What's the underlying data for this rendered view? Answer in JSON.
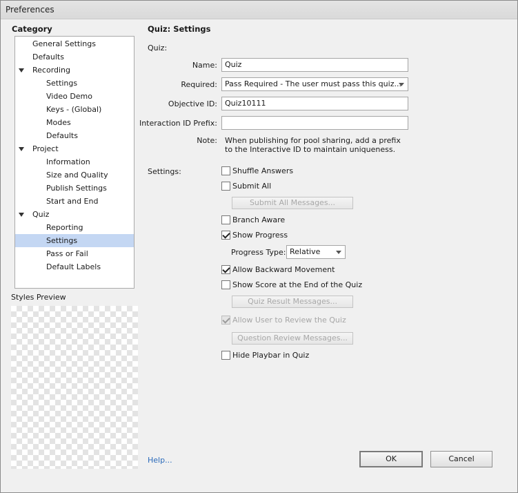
{
  "window": {
    "title": "Preferences"
  },
  "category": {
    "heading": "Category",
    "items": [
      {
        "label": "General Settings",
        "level": 1,
        "expandable": false,
        "selected": false
      },
      {
        "label": "Defaults",
        "level": 1,
        "expandable": false,
        "selected": false
      },
      {
        "label": "Recording",
        "level": 1,
        "expandable": true,
        "selected": false
      },
      {
        "label": "Settings",
        "level": 2,
        "expandable": false,
        "selected": false
      },
      {
        "label": "Video Demo",
        "level": 2,
        "expandable": false,
        "selected": false
      },
      {
        "label": "Keys - (Global)",
        "level": 2,
        "expandable": false,
        "selected": false
      },
      {
        "label": "Modes",
        "level": 2,
        "expandable": false,
        "selected": false
      },
      {
        "label": "Defaults",
        "level": 2,
        "expandable": false,
        "selected": false
      },
      {
        "label": "Project",
        "level": 1,
        "expandable": true,
        "selected": false
      },
      {
        "label": "Information",
        "level": 2,
        "expandable": false,
        "selected": false
      },
      {
        "label": "Size and Quality",
        "level": 2,
        "expandable": false,
        "selected": false
      },
      {
        "label": "Publish Settings",
        "level": 2,
        "expandable": false,
        "selected": false
      },
      {
        "label": "Start and End",
        "level": 2,
        "expandable": false,
        "selected": false
      },
      {
        "label": "Quiz",
        "level": 1,
        "expandable": true,
        "selected": false
      },
      {
        "label": "Reporting",
        "level": 2,
        "expandable": false,
        "selected": false
      },
      {
        "label": "Settings",
        "level": 2,
        "expandable": false,
        "selected": true
      },
      {
        "label": "Pass or Fail",
        "level": 2,
        "expandable": false,
        "selected": false
      },
      {
        "label": "Default Labels",
        "level": 2,
        "expandable": false,
        "selected": false
      }
    ]
  },
  "styles_preview": {
    "label": "Styles Preview"
  },
  "panel": {
    "heading": "Quiz: Settings",
    "quiz_section": "Quiz:",
    "name_label": "Name:",
    "name_value": "Quiz",
    "required_label": "Required:",
    "required_value": "Pass Required - The user must pass this quiz...",
    "objective_label": "Objective ID:",
    "objective_value": "Quiz10111",
    "interaction_label": "Interaction ID Prefix:",
    "interaction_value": "",
    "note_label": "Note:",
    "note_line1": "When publishing for pool sharing, add a prefix",
    "note_line2": "to the Interactive ID to maintain uniqueness.",
    "settings_section": "Settings:",
    "shuffle_answers": "Shuffle Answers",
    "submit_all": "Submit All",
    "submit_all_messages": "Submit All Messages...",
    "branch_aware": "Branch Aware",
    "show_progress": "Show Progress",
    "progress_type_label": "Progress Type:",
    "progress_type_value": "Relative",
    "allow_backward": "Allow Backward Movement",
    "show_score": "Show Score at the End of the Quiz",
    "quiz_result_messages": "Quiz Result Messages...",
    "allow_review": "Allow User to Review the Quiz",
    "question_review_messages": "Question Review Messages...",
    "hide_playbar": "Hide Playbar in Quiz"
  },
  "states": {
    "shuffle_answers": false,
    "submit_all": false,
    "branch_aware": false,
    "show_progress": true,
    "allow_backward": true,
    "show_score": false,
    "allow_review": true,
    "allow_review_enabled": false,
    "hide_playbar": false
  },
  "footer": {
    "help": "Help...",
    "ok": "OK",
    "cancel": "Cancel"
  },
  "colors": {
    "selection": "#c4d7f3",
    "link": "#2a6aba"
  }
}
